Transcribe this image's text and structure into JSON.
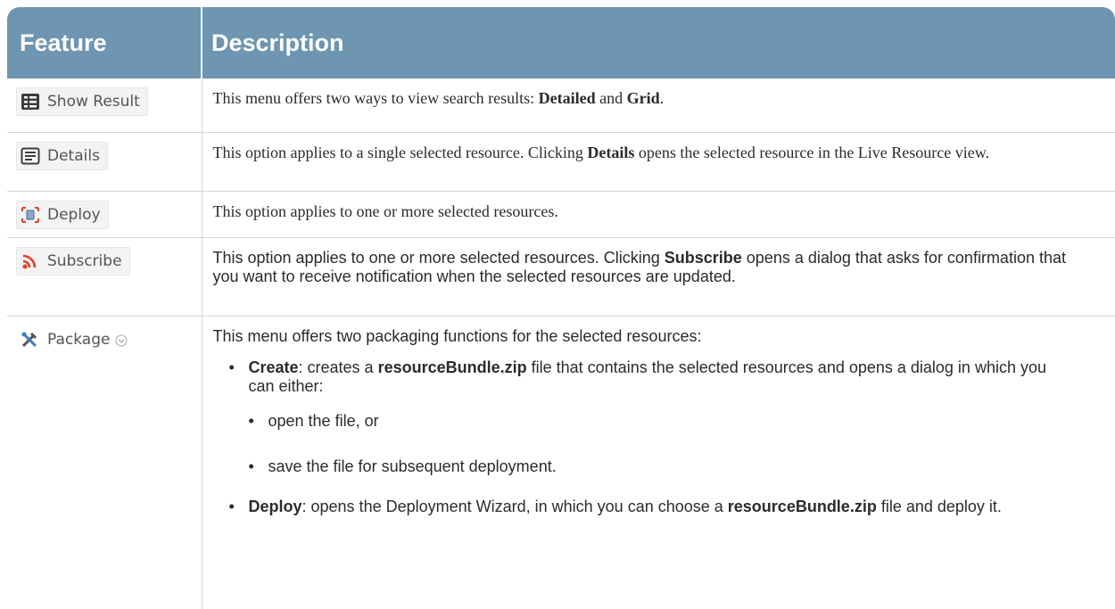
{
  "header": {
    "feature": "Feature",
    "description": "Description"
  },
  "rows": [
    {
      "button_label": "Show Result",
      "icon": "list-view-icon",
      "desc_a": "This menu offers two ways to view search results: ",
      "bold_a": "Detailed",
      "desc_b": " and ",
      "bold_b": "Grid",
      "desc_c": "."
    },
    {
      "button_label": "Details",
      "icon": "details-icon",
      "desc_a": "This option applies to a single selected resource. Clicking ",
      "bold_a": "Details",
      "desc_b": " opens the selected resource in the Live Resource view."
    },
    {
      "button_label": "Deploy",
      "icon": "deploy-icon",
      "desc_a": "This option applies to one or more selected resources."
    },
    {
      "button_label": "Subscribe",
      "icon": "rss-icon",
      "desc_a": "This option applies to one or more selected resources. Clicking ",
      "bold_a": "Subscribe",
      "desc_b": " opens a dialog that asks for confirmation that you want to receive notification when the selected resources are updated."
    },
    {
      "button_label": "Package",
      "icon": "tools-icon",
      "lead": "This menu offers two packaging functions for the selected resources:",
      "create_bold": "Create",
      "create_a": ": creates a ",
      "create_file": "resourceBundle.zip",
      "create_b": " file that contains the selected resources and opens a dialog in which you can either:",
      "sub_items": [
        "open the file, or",
        "save the file for subsequent deployment."
      ],
      "deploy_bold": "Deploy",
      "deploy_a": ": opens the Deployment Wizard, in which you can choose a ",
      "deploy_file": "resourceBundle.zip",
      "deploy_b": " file and deploy it."
    }
  ]
}
